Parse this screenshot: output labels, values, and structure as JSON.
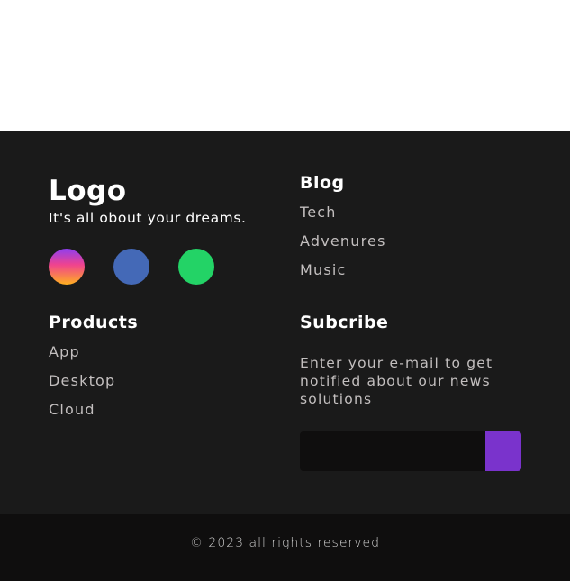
{
  "brand": {
    "logo": "Logo",
    "tagline": "It's all obout your dreams."
  },
  "socials": [
    {
      "icon": "instagram-icon",
      "color": "#d94794"
    },
    {
      "icon": "facebook-icon",
      "color": "#4469b7"
    },
    {
      "icon": "whatsapp-icon",
      "color": "#23d366"
    }
  ],
  "products": {
    "heading": "Products",
    "items": [
      "App",
      "Desktop",
      "Cloud"
    ]
  },
  "blog": {
    "heading": "Blog",
    "items": [
      "Tech",
      "Advenures",
      "Music"
    ]
  },
  "subscribe": {
    "heading": "Subcribe",
    "text": "Enter your e-mail to get notified about our news solutions",
    "input_value": "",
    "button_color": "#7a33cc"
  },
  "footer": {
    "copyright": "© 2023 all rights reserved"
  },
  "colors": {
    "footer_bg": "#1a1a1a",
    "bottom_bar_bg": "#0f0e0e",
    "accent": "#7a33cc"
  }
}
